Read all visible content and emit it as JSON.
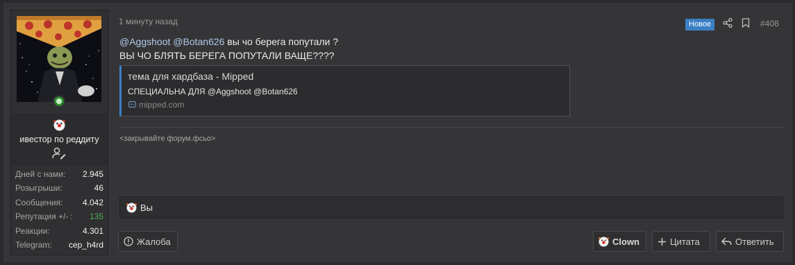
{
  "user": {
    "title": "ивестор по реддиту",
    "avatar_icon": "pizza-avatar",
    "badge_icon": "clown-badge-icon",
    "stats": [
      {
        "key": "Дней с нами:",
        "value": "2.945"
      },
      {
        "key": "Розыгрыши:",
        "value": "46"
      },
      {
        "key": "Сообщения:",
        "value": "4.042"
      },
      {
        "key": "Репутация +/- :",
        "value": "135",
        "color": "#4fae4f"
      },
      {
        "key": "Реакции:",
        "value": "4.301"
      },
      {
        "key": "Telegram:",
        "value": "cep_h4rd"
      }
    ]
  },
  "post": {
    "time": "1 минуту назад",
    "badge_new": "Новое",
    "number": "#408",
    "line1": {
      "mention1": "@Aggshoot",
      "mention2": "@Botan626",
      "text": " вы чо берега попутали ?"
    },
    "line2": "ВЫ ЧО БЛЯТЬ БЕРЕГА ПОПУТАЛИ ВАЩЕ????",
    "embed": {
      "title": "тема для хардбаза - Mipped",
      "description": "СПЕЦИАЛЬНА ДЛЯ @Aggshoot @Botan626",
      "site": "mipped.com"
    },
    "signature": "<закрывайте форум.фсьо>",
    "reactions_summary": "Вы"
  },
  "actions": {
    "report": "Жалоба",
    "clown": "Clown",
    "quote": "Цитата",
    "reply": "Ответить"
  },
  "colors": {
    "accent": "#3b7fc4",
    "online": "#2f8a2f",
    "positive": "#4fae4f"
  }
}
